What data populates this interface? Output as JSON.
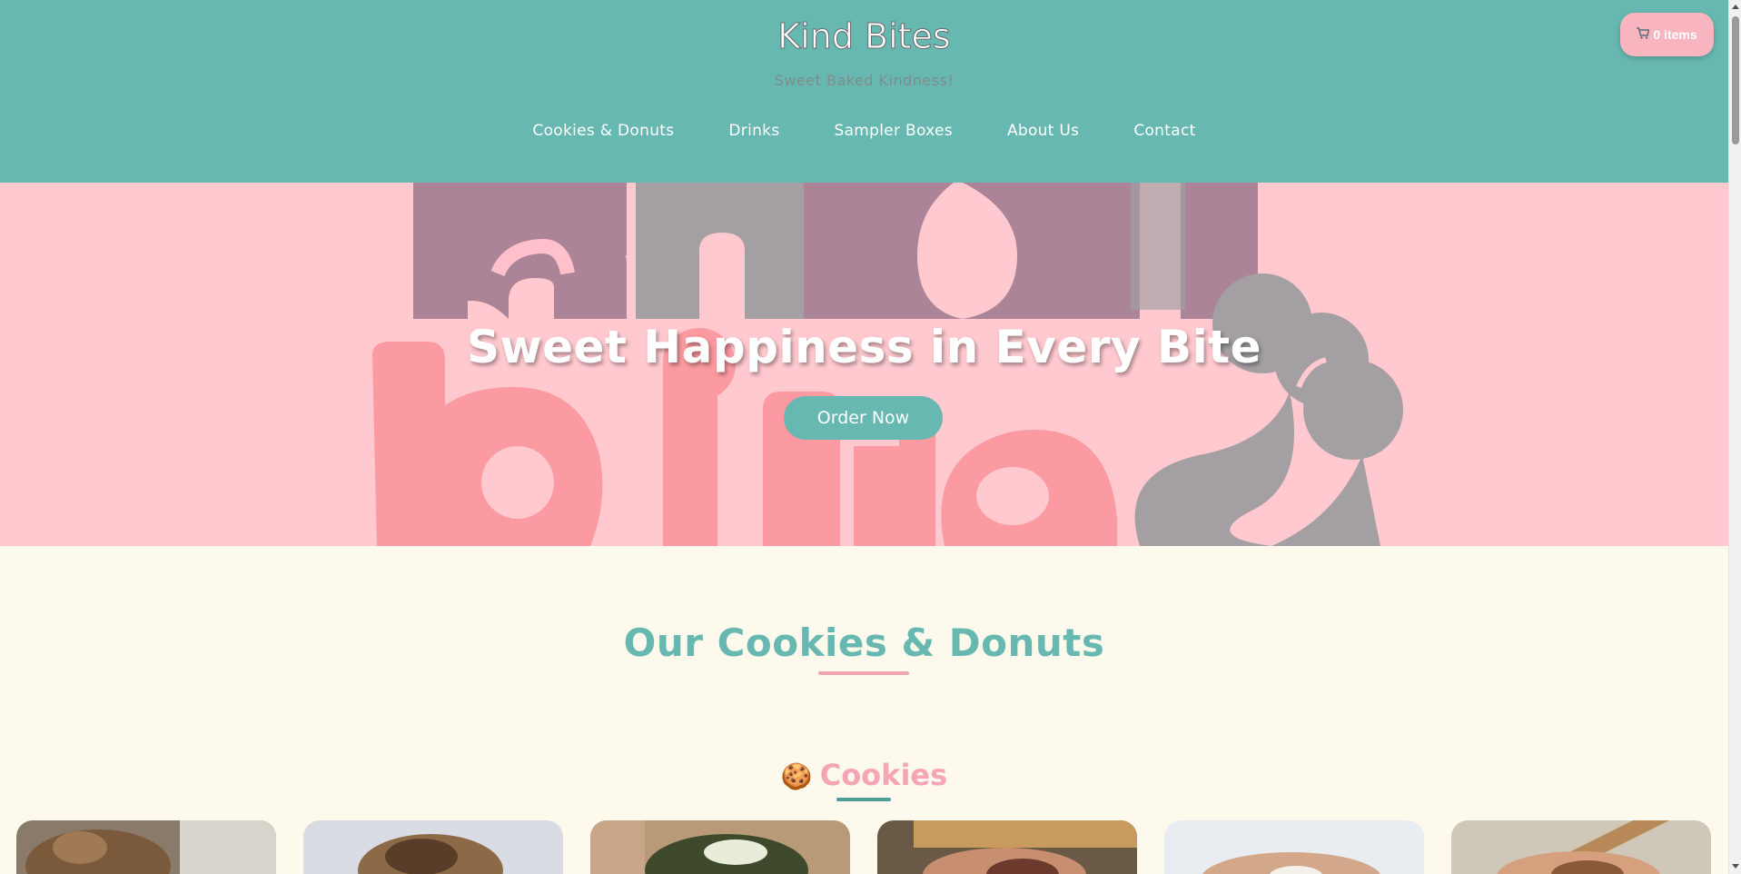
{
  "header": {
    "title": "Kind Bites",
    "tagline": "Sweet Baked Kindness!",
    "nav": [
      {
        "label": "Cookies & Donuts"
      },
      {
        "label": "Drinks"
      },
      {
        "label": "Sampler Boxes"
      },
      {
        "label": "About Us"
      },
      {
        "label": "Contact"
      }
    ],
    "cart": {
      "icon": "shopping-cart-icon",
      "label": "0 items"
    }
  },
  "hero": {
    "heading": "Sweet Happiness in Every Bite",
    "button_label": "Order Now",
    "background_logo": "kind bites"
  },
  "products": {
    "title": "Our Cookies & Donuts",
    "category": {
      "icon": "cookie-icon",
      "emoji": "🍪",
      "label": "Cookies"
    }
  },
  "colors": {
    "primary": "#67b8b1",
    "accent_pink": "#f8b5c0",
    "hero_bg": "#ffc9cf",
    "page_bg": "#fdf9ec"
  }
}
